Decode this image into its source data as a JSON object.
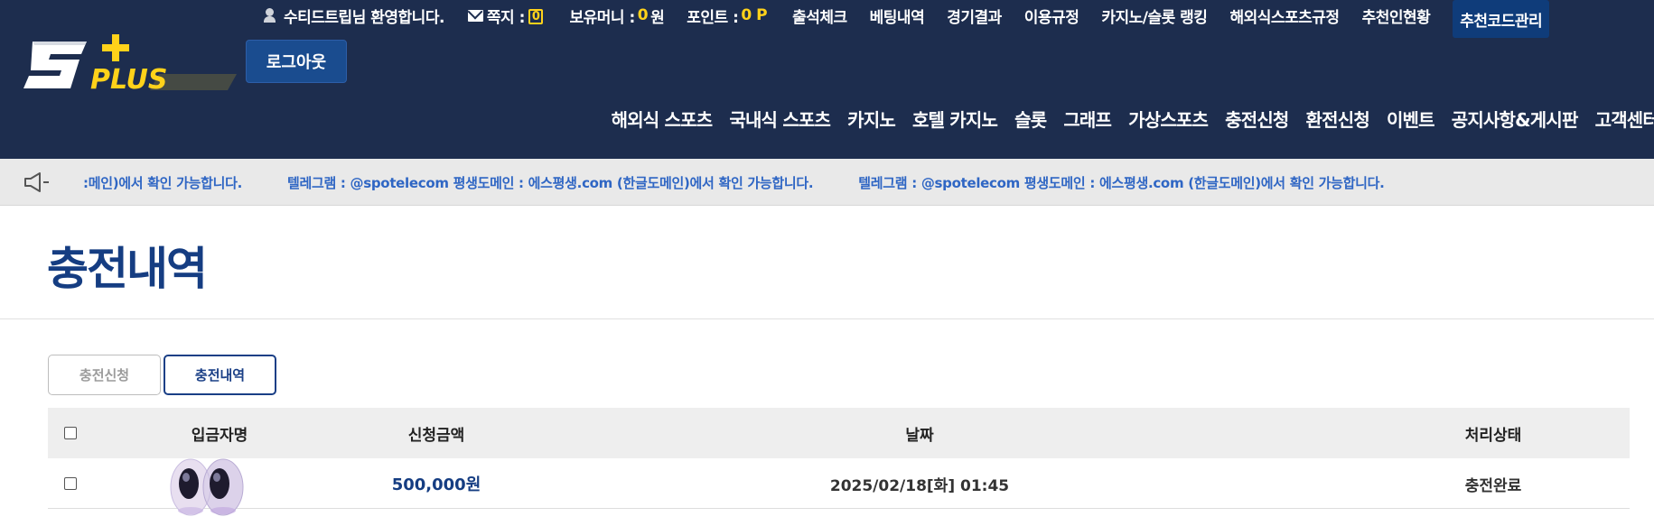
{
  "header": {
    "welcome": "수티드트립님 환영합니다.",
    "messages_label": "쪽지 :",
    "messages_count": "0",
    "money_label": "보유머니 :",
    "money_value": "0",
    "money_unit": "원",
    "points_label": "포인트 :",
    "points_value": "0 P",
    "top_links": [
      "출석체크",
      "베팅내역",
      "경기결과",
      "이용규정",
      "카지노/슬롯 랭킹",
      "해외식스포츠규정",
      "추천인현황",
      "추천코드관리"
    ],
    "logout_label": "로그아웃",
    "logo_text": "S+PLUS",
    "nav_items": [
      "해외식 스포츠",
      "국내식 스포츠",
      "카지노",
      "호텔 카지노",
      "슬롯",
      "그래프",
      "가상스포츠",
      "충전신청",
      "환전신청",
      "이벤트",
      "공지사항&게시판",
      "고객센터"
    ]
  },
  "ticker": {
    "msg_partial": ":메인)에서 확인 가능합니다.",
    "msg_full": "텔레그램 : @spotelecom 평생도메인 : 에스평생.com (한글도메인)에서 확인 가능합니다.",
    "msg_tail": "텔레그램 : @spotelecom 평생도메인 : 에스평생.com (한글도메인)에서 확인 가능합니다."
  },
  "page": {
    "title": "충전내역",
    "tabs": [
      "충전신청",
      "충전내역"
    ]
  },
  "table": {
    "headers": [
      "입금자명",
      "신청금액",
      "날짜",
      "처리상태"
    ],
    "rows": [
      {
        "name": "",
        "amount": "500,000원",
        "date": "2025/02/18[화] 01:45",
        "status": "충전완료"
      }
    ]
  },
  "colors": {
    "header_bg": "#1d2d4e",
    "accent_yellow": "#ffd21a",
    "title_blue": "#153d82",
    "ticker_blue": "#2f66c4"
  }
}
